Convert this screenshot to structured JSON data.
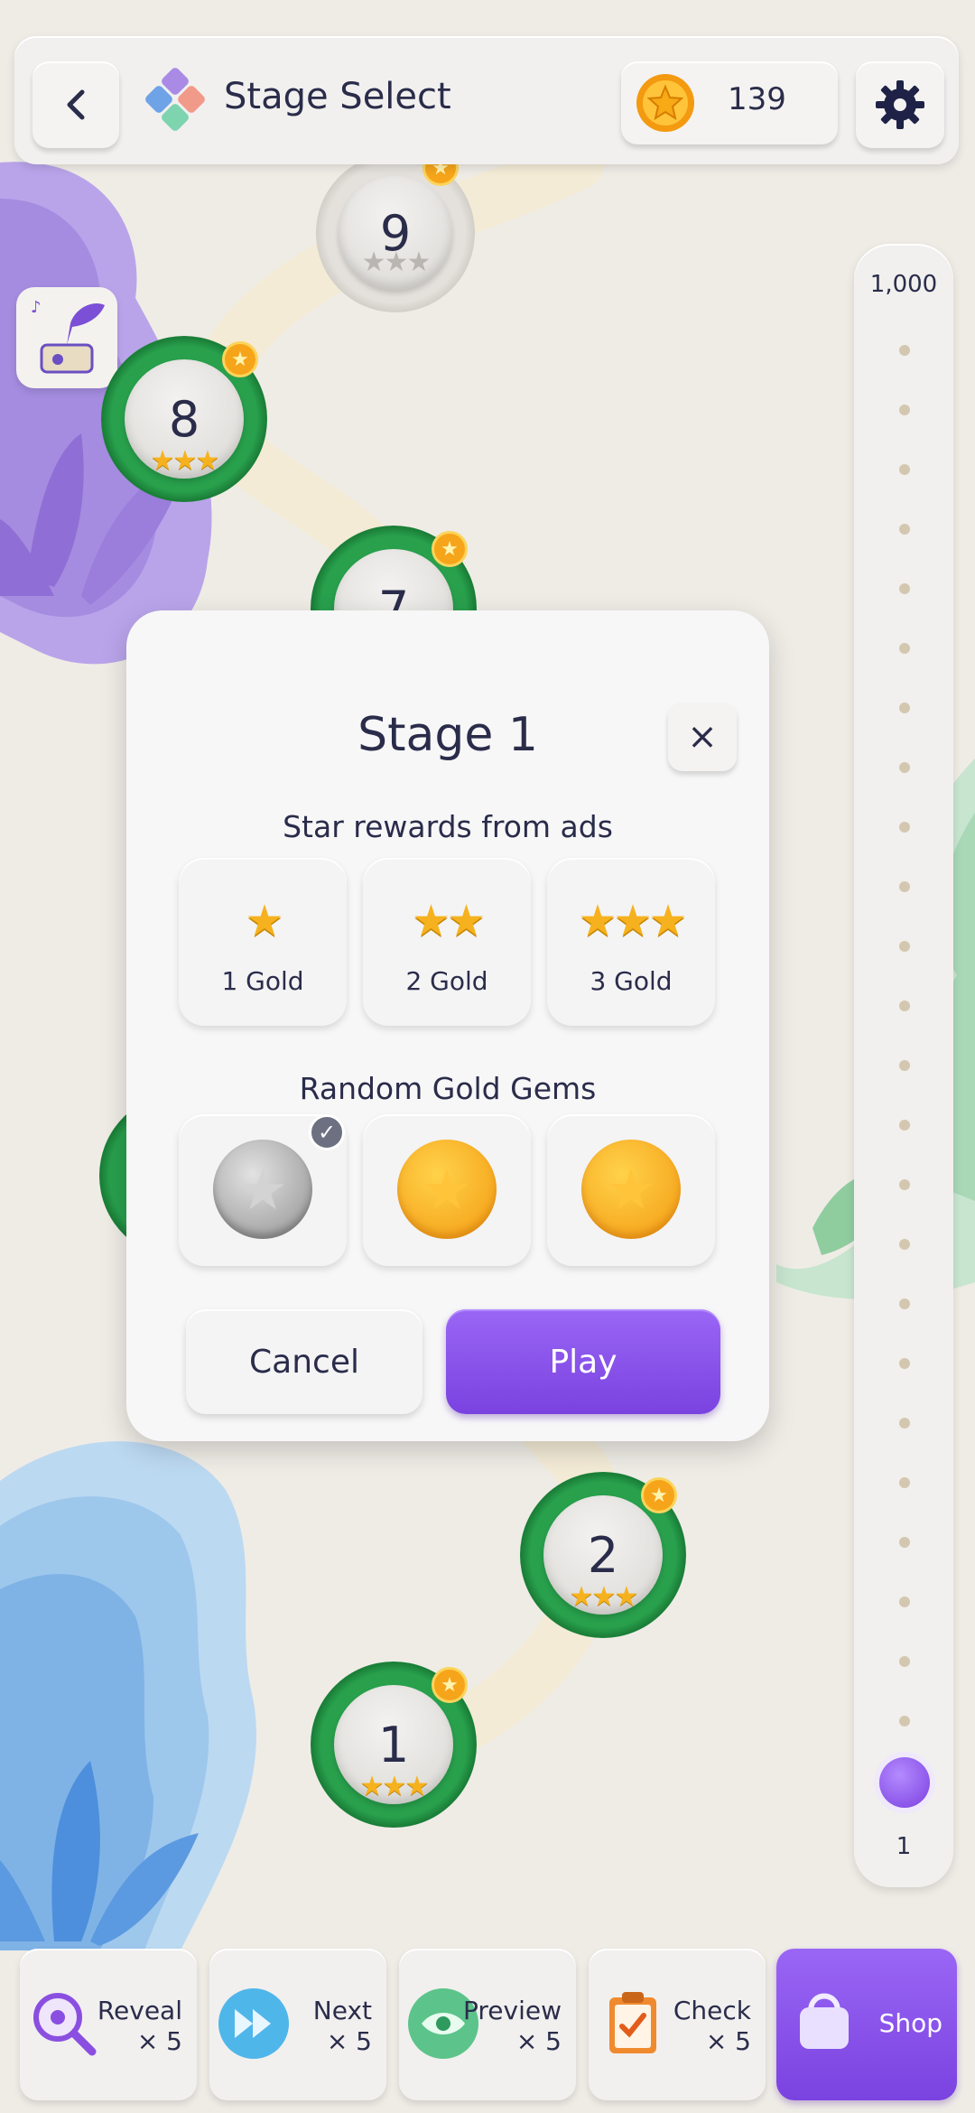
{
  "header": {
    "title": "Stage Select",
    "coins": "139"
  },
  "map": {
    "nodes": [
      {
        "label": "9"
      },
      {
        "label": "8"
      },
      {
        "label": "7"
      },
      {
        "label": "2"
      },
      {
        "label": "1"
      }
    ]
  },
  "slider": {
    "max_label": "1,000",
    "min_label": "1",
    "current_level": 1
  },
  "dialog": {
    "title": "Stage 1",
    "close_glyph": "×",
    "rewards_heading": "Star rewards from ads",
    "rewards": [
      {
        "stars": "★",
        "label": "1 Gold"
      },
      {
        "stars": "★★",
        "label": "2 Gold"
      },
      {
        "stars": "★★★",
        "label": "3 Gold"
      }
    ],
    "gems_heading": "Random Gold Gems",
    "gems": [
      "silver-star-gem (selected)",
      "gold-star-gem",
      "gold-star-gem"
    ],
    "cancel_label": "Cancel",
    "play_label": "Play"
  },
  "toolbar": {
    "items": [
      {
        "name": "Reveal",
        "count": "× 5",
        "icon": "magnifier-eye-icon"
      },
      {
        "name": "Next",
        "count": "× 5",
        "icon": "fast-forward-icon"
      },
      {
        "name": "Preview",
        "count": "× 5",
        "icon": "eye-icon"
      },
      {
        "name": "Check",
        "count": "× 5",
        "icon": "clipboard-check-icon"
      }
    ],
    "shop_label": "Shop"
  },
  "colors": {
    "accent_purple": "#7a42e0",
    "node_green": "#28a04c",
    "gold": "#f6a51b",
    "background": "#efece6"
  }
}
